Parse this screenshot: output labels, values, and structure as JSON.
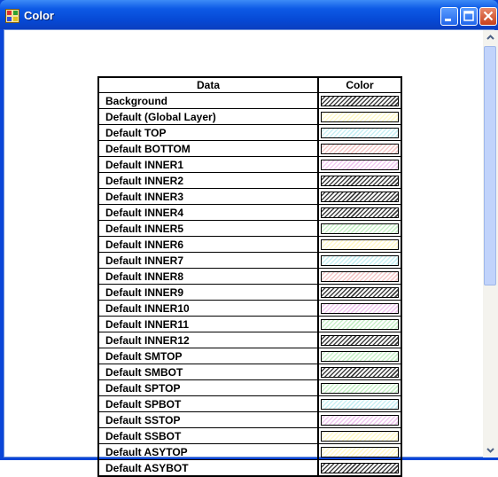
{
  "window": {
    "title": "Color"
  },
  "table": {
    "headers": {
      "data": "Data",
      "color": "Color"
    },
    "rows": [
      {
        "label": "Background",
        "color": "#404040"
      },
      {
        "label": "Default (Global Layer)",
        "color": "#fff9c8"
      },
      {
        "label": "Default TOP",
        "color": "#c8f0f4"
      },
      {
        "label": "Default BOTTOM",
        "color": "#f4c8c8"
      },
      {
        "label": "Default INNER1",
        "color": "#f0c8f0"
      },
      {
        "label": "Default INNER2",
        "color": "#404040"
      },
      {
        "label": "Default INNER3",
        "color": "#404040"
      },
      {
        "label": "Default INNER4",
        "color": "#404040"
      },
      {
        "label": "Default INNER5",
        "color": "#c8f0c8"
      },
      {
        "label": "Default INNER6",
        "color": "#fff9c8"
      },
      {
        "label": "Default INNER7",
        "color": "#c8f0f4"
      },
      {
        "label": "Default INNER8",
        "color": "#f4c8c8"
      },
      {
        "label": "Default INNER9",
        "color": "#404040"
      },
      {
        "label": "Default INNER10",
        "color": "#f0c8f0"
      },
      {
        "label": "Default INNER11",
        "color": "#c8f0c8"
      },
      {
        "label": "Default INNER12",
        "color": "#404040"
      },
      {
        "label": "Default SMTOP",
        "color": "#c8f0c8"
      },
      {
        "label": "Default SMBOT",
        "color": "#404040"
      },
      {
        "label": "Default SPTOP",
        "color": "#c8f0c8"
      },
      {
        "label": "Default SPBOT",
        "color": "#c8f0f4"
      },
      {
        "label": "Default SSTOP",
        "color": "#f0c8f0"
      },
      {
        "label": "Default SSBOT",
        "color": "#fff9c8"
      },
      {
        "label": "Default ASYTOP",
        "color": "#fff9c8"
      },
      {
        "label": "Default ASYBOT",
        "color": "#404040"
      }
    ]
  }
}
